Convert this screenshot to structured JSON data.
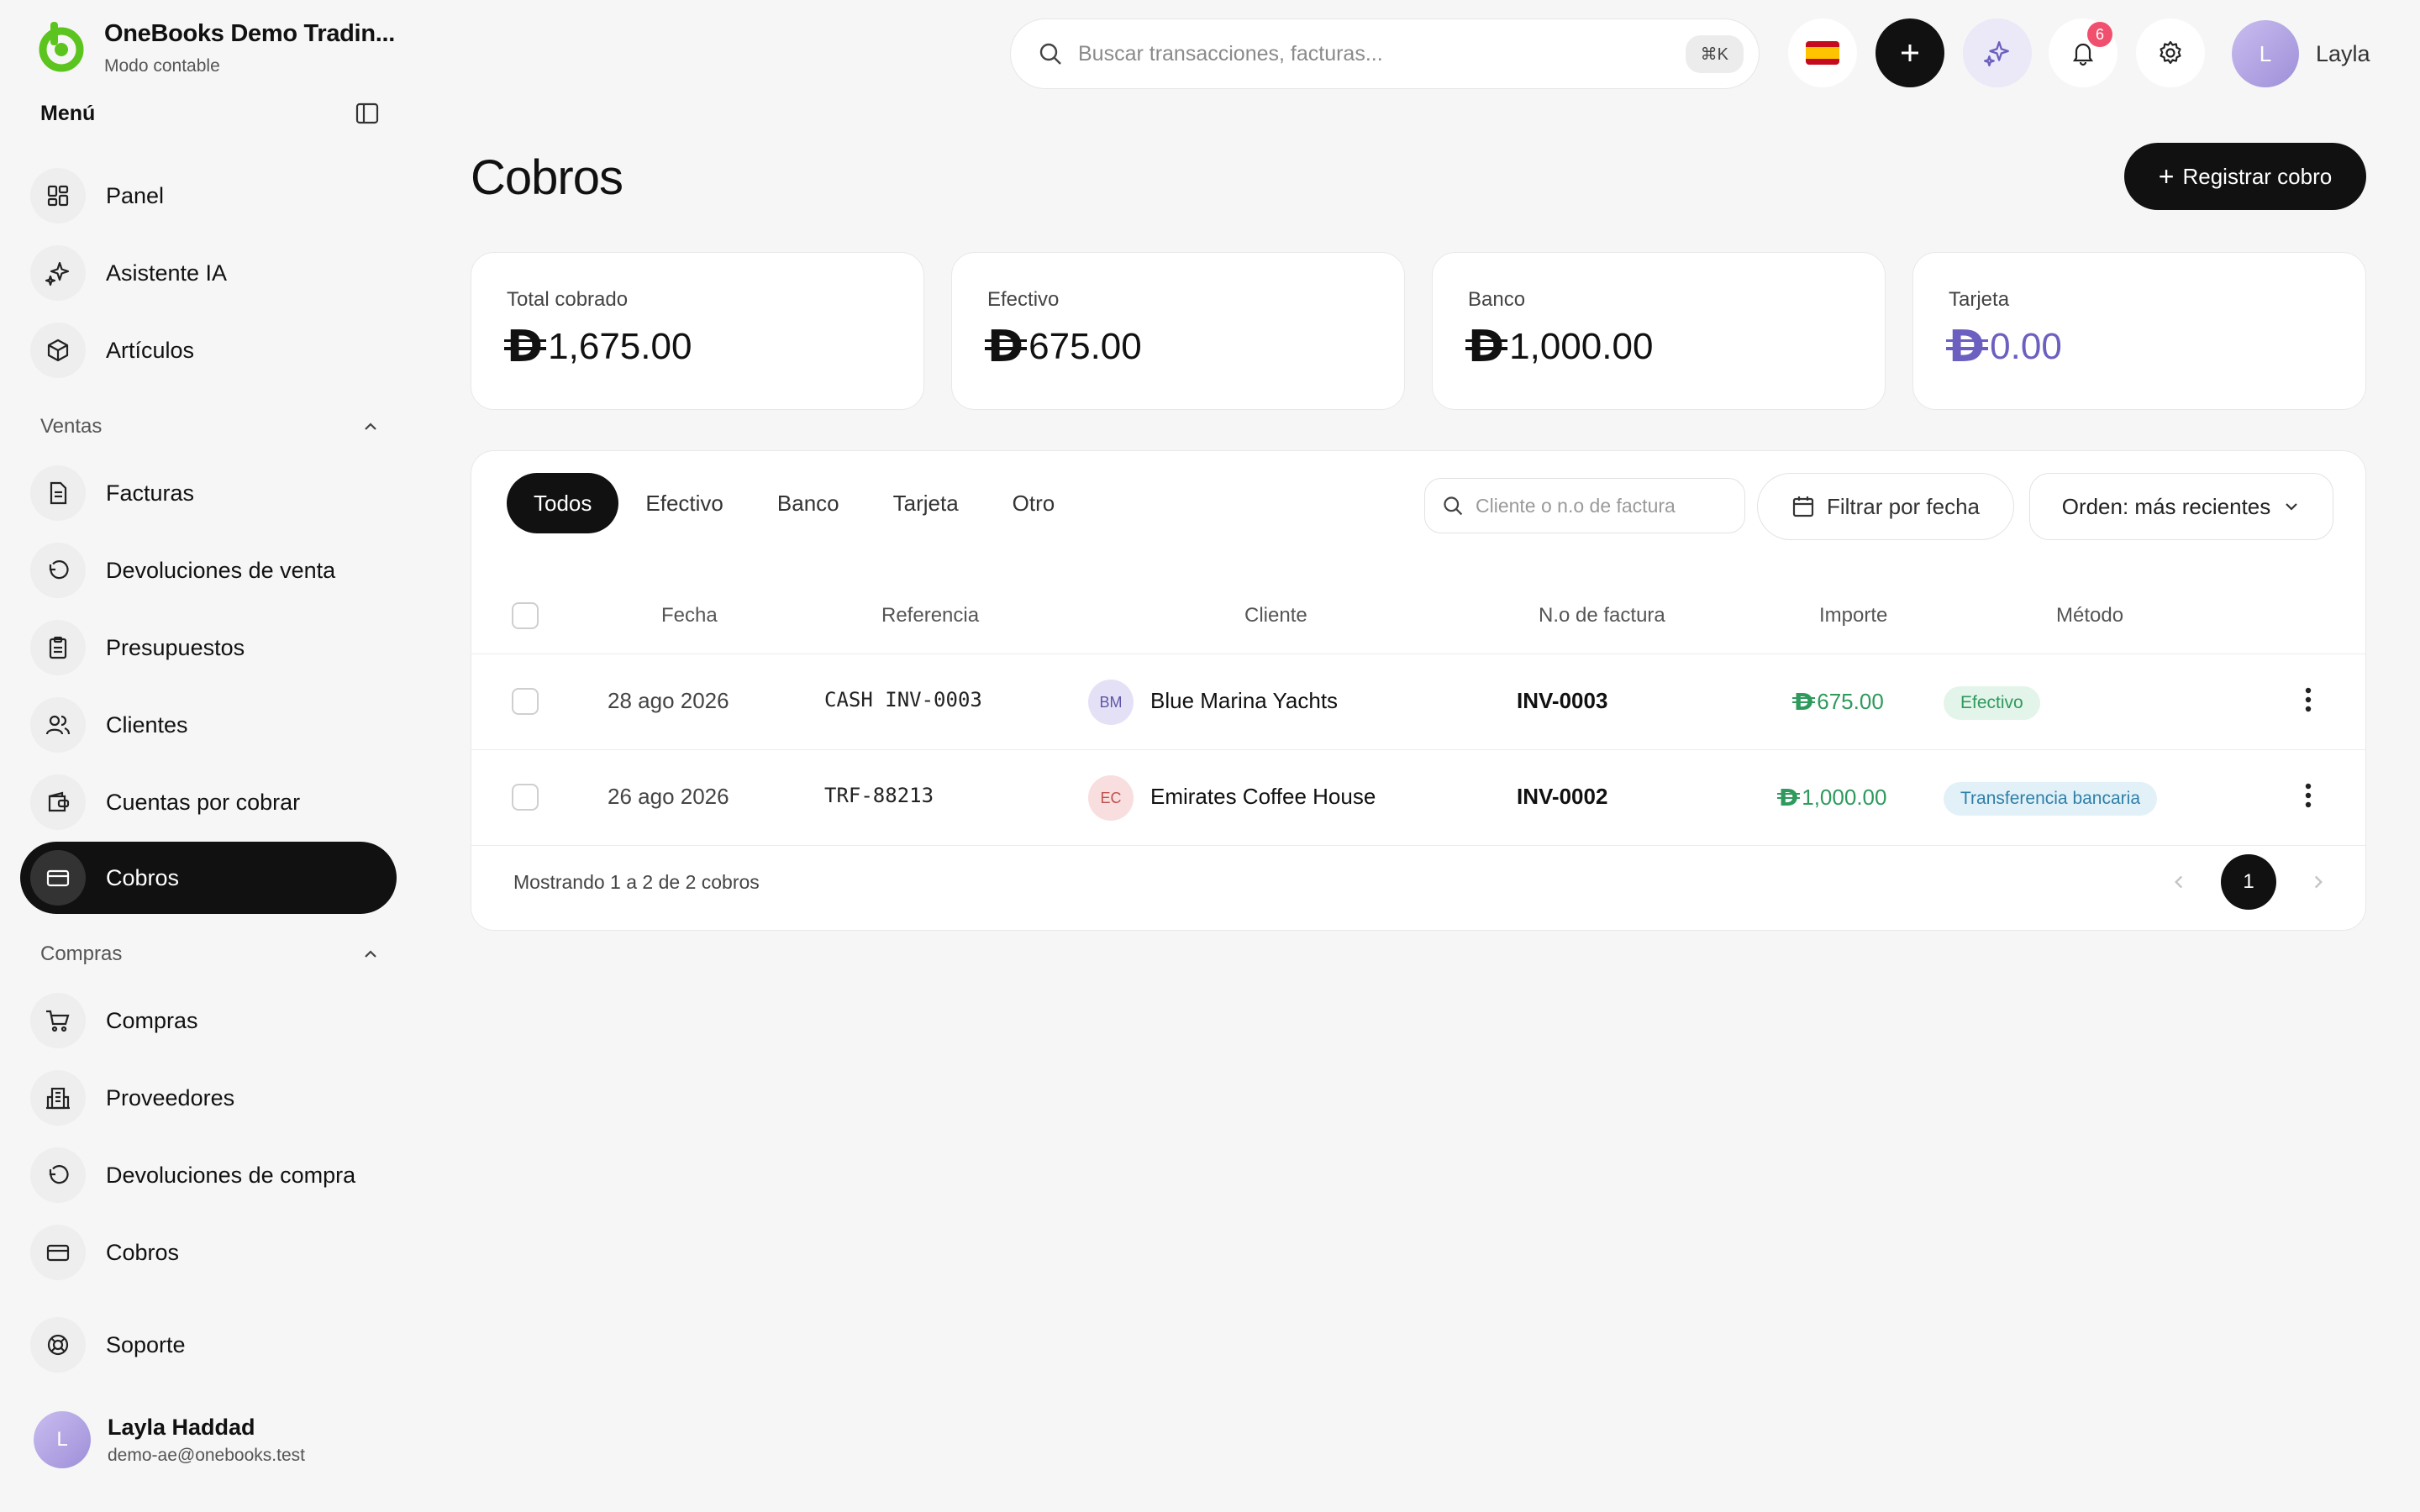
{
  "brand": {
    "title": "OneBooks Demo Tradin...",
    "subtitle": "Modo contable"
  },
  "menu": {
    "title": "Menú"
  },
  "nav": {
    "main": [
      {
        "label": "Panel",
        "icon": "dashboard-icon"
      },
      {
        "label": "Asistente IA",
        "icon": "sparkles-icon"
      },
      {
        "label": "Artículos",
        "icon": "box-icon"
      }
    ],
    "ventas_title": "Ventas",
    "ventas": [
      {
        "label": "Facturas",
        "icon": "document-icon"
      },
      {
        "label": "Devoluciones de venta",
        "icon": "undo-icon"
      },
      {
        "label": "Presupuestos",
        "icon": "clipboard-icon"
      },
      {
        "label": "Clientes",
        "icon": "users-icon"
      },
      {
        "label": "Cuentas por cobrar",
        "icon": "wallet-icon"
      },
      {
        "label": "Cobros",
        "icon": "card-icon",
        "active": true
      }
    ],
    "compras_title": "Compras",
    "compras": [
      {
        "label": "Compras",
        "icon": "cart-icon"
      },
      {
        "label": "Proveedores",
        "icon": "building-icon"
      },
      {
        "label": "Devoluciones de compra",
        "icon": "undo-icon"
      },
      {
        "label": "Cobros",
        "icon": "card-icon"
      }
    ],
    "support": "Soporte"
  },
  "user": {
    "initial": "L",
    "name": "Layla Haddad",
    "email": "demo-ae@onebooks.test",
    "short_name": "Layla"
  },
  "topbar": {
    "search_placeholder": "Buscar transacciones, facturas...",
    "shortcut": "⌘K",
    "notifications": "6"
  },
  "page": {
    "title": "Cobros",
    "primary_action": "Registrar cobro",
    "primary_action_icon": "+"
  },
  "currency_symbol": "D",
  "stats": [
    {
      "label": "Total cobrado",
      "value": "1,675.00",
      "color": "#111111"
    },
    {
      "label": "Efectivo",
      "value": "675.00",
      "color": "#111111"
    },
    {
      "label": "Banco",
      "value": "1,000.00",
      "color": "#111111"
    },
    {
      "label": "Tarjeta",
      "value": "0.00",
      "color": "#6b5fc0"
    }
  ],
  "filters": {
    "tabs": [
      "Todos",
      "Efectivo",
      "Banco",
      "Tarjeta",
      "Otro"
    ],
    "active_tab": "Todos",
    "search_placeholder": "Cliente o n.o de factura",
    "date_label": "Filtrar por fecha",
    "order_label": "Orden: más recientes"
  },
  "table": {
    "columns": [
      "Fecha",
      "Referencia",
      "Cliente",
      "N.o de factura",
      "Importe",
      "Método"
    ],
    "rows": [
      {
        "date": "28 ago 2026",
        "reference": "CASH INV-0003",
        "client_initials": "BM",
        "client": "Blue Marina Yachts",
        "invoice": "INV-0003",
        "amount": "675.00",
        "method": "Efectivo",
        "method_color": "#2e9a5c"
      },
      {
        "date": "26 ago 2026",
        "reference": "TRF-88213",
        "client_initials": "EC",
        "client": "Emirates Coffee House",
        "invoice": "INV-0002",
        "amount": "1,000.00",
        "method": "Transferencia bancaria",
        "method_color": "#2f7fa8"
      }
    ]
  },
  "pagination": {
    "summary": "Mostrando 1 a 2 de 2 cobros",
    "current": "1"
  }
}
